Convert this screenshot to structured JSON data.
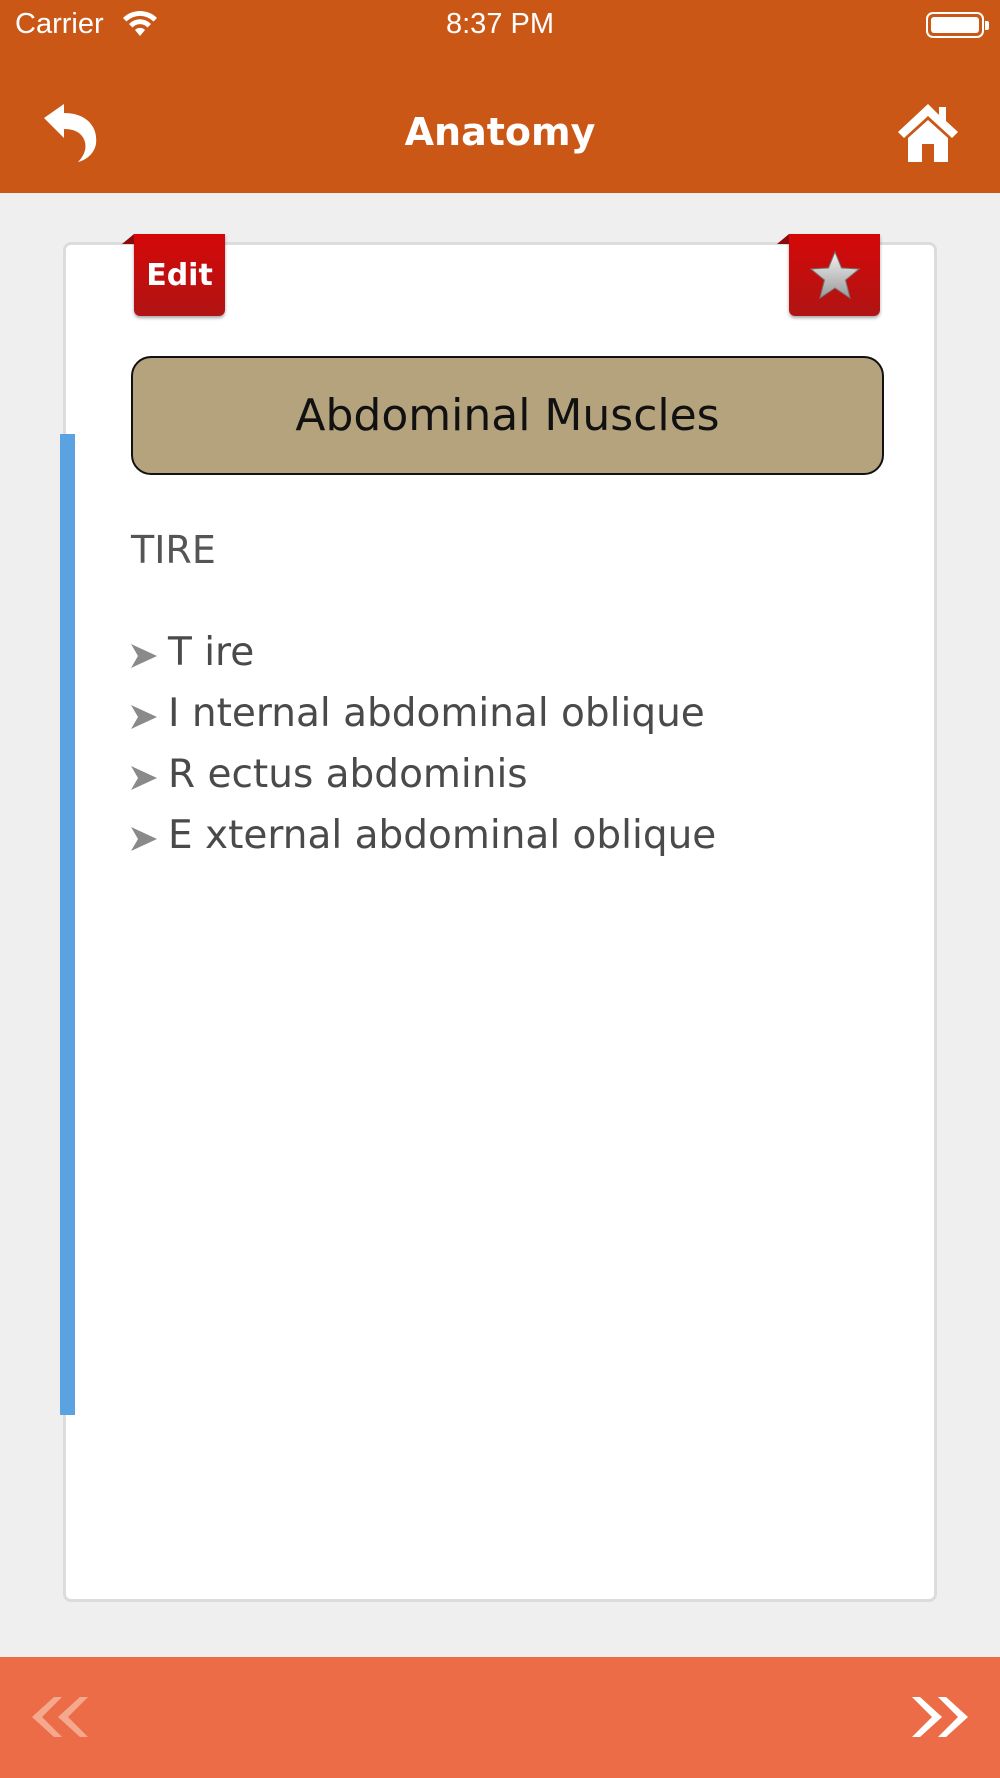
{
  "status_bar": {
    "carrier": "Carrier",
    "time": "8:37 PM"
  },
  "nav": {
    "title": "Anatomy",
    "back_icon": "back-arrow-icon",
    "home_icon": "home-icon"
  },
  "card": {
    "edit_label": "Edit",
    "favorite_icon": "star-icon",
    "heading": "Abdominal Muscles",
    "mnemonic": "TIRE",
    "items": [
      "T ire",
      "I nternal abdominal oblique",
      "R ectus abdominis",
      "E xternal abdominal oblique"
    ]
  },
  "bottom_bar": {
    "prev_icon": "double-chevron-left-icon",
    "next_icon": "double-chevron-right-icon"
  },
  "colors": {
    "nav_bg": "#cb5716",
    "bottom_bg": "#ec6c47",
    "heading_bg": "#b5a37e",
    "ribbon_red": "#d50808",
    "accent_blue": "#5ba3e0"
  }
}
